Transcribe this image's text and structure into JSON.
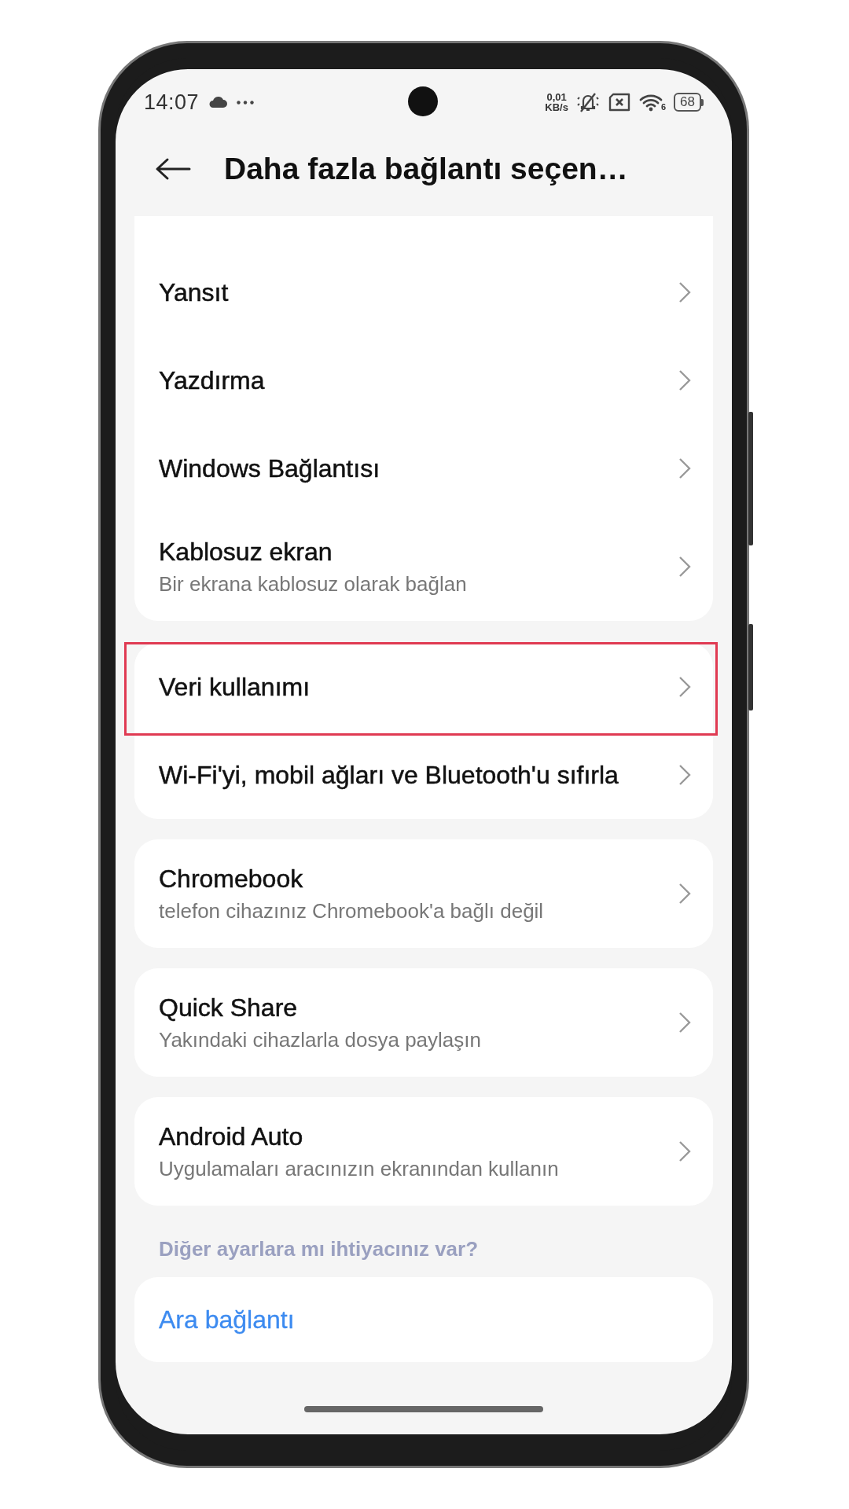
{
  "status_bar": {
    "time": "14:07",
    "network_speed": [
      "0,01",
      "KB/s"
    ],
    "wifi_badge": "6",
    "battery": "68"
  },
  "header": {
    "title": "Daha fazla bağlantı seçen…"
  },
  "groups": [
    {
      "items": [
        {
          "title": "Yansıt",
          "highlighted": false
        },
        {
          "title": "Yazdırma",
          "highlighted": false
        },
        {
          "title": "Windows Bağlantısı",
          "highlighted": false
        },
        {
          "title": "Kablosuz ekran",
          "subtitle": "Bir ekrana kablosuz olarak bağlan",
          "highlighted": false
        }
      ]
    },
    {
      "items": [
        {
          "title": "Veri kullanımı",
          "highlighted": true
        },
        {
          "title": "Wi-Fi'yi, mobil ağları ve Bluetooth'u sıfırla",
          "highlighted": false
        }
      ]
    },
    {
      "items": [
        {
          "title": "Chromebook",
          "subtitle": "telefon cihazınız Chromebook'a bağlı değil",
          "highlighted": false
        }
      ]
    },
    {
      "items": [
        {
          "title": "Quick Share",
          "subtitle": "Yakındaki cihazlarla dosya paylaşın",
          "highlighted": false
        }
      ]
    },
    {
      "items": [
        {
          "title": "Android Auto",
          "subtitle": "Uygulamaları aracınızın ekranından kullanın",
          "highlighted": false
        }
      ]
    }
  ],
  "section_label": "Diğer ayarlara mı ihtiyacınız var?",
  "link_card": {
    "label": "Ara bağlantı"
  }
}
